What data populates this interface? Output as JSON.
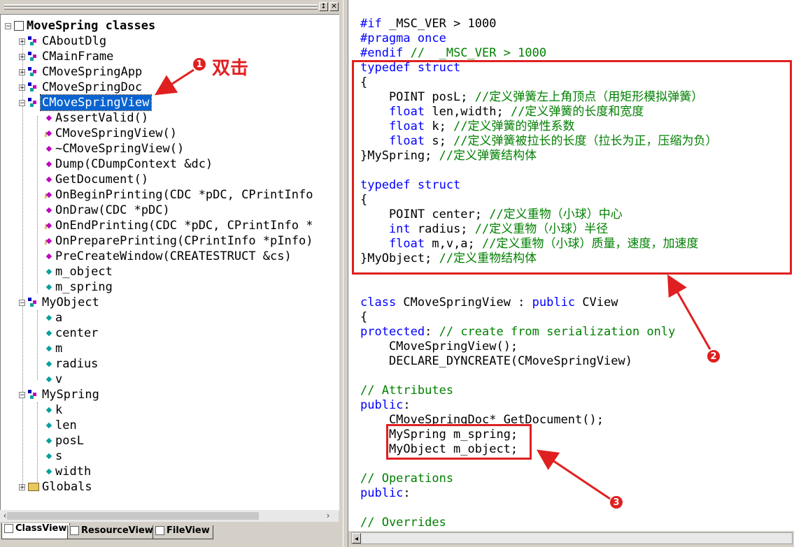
{
  "colors": {
    "keyword": "#0000ff",
    "comment": "#008000",
    "annotation": "#e02020",
    "selection": "#0a64d0"
  },
  "class_tree": {
    "root": "MoveSpring classes",
    "items": [
      {
        "label": "CAboutDlg",
        "icon": "class-icon"
      },
      {
        "label": "CMainFrame",
        "icon": "class-icon"
      },
      {
        "label": "CMoveSpringApp",
        "icon": "class-icon"
      },
      {
        "label": "CMoveSpringDoc",
        "icon": "class-icon"
      },
      {
        "label": "CMoveSpringView",
        "icon": "class-icon",
        "selected": true
      },
      {
        "label": "AssertValid()",
        "icon": "method-icon"
      },
      {
        "label": "CMoveSpringView()",
        "icon": "public-method-key-icon"
      },
      {
        "label": "~CMoveSpringView()",
        "icon": "method-icon"
      },
      {
        "label": "Dump(CDumpContext &dc)",
        "icon": "method-icon"
      },
      {
        "label": "GetDocument()",
        "icon": "method-icon"
      },
      {
        "label": "OnBeginPrinting(CDC *pDC, CPrintInfo",
        "icon": "public-method-key-icon"
      },
      {
        "label": "OnDraw(CDC *pDC)",
        "icon": "method-icon"
      },
      {
        "label": "OnEndPrinting(CDC *pDC, CPrintInfo *",
        "icon": "public-method-key-icon"
      },
      {
        "label": "OnPreparePrinting(CPrintInfo *pInfo)",
        "icon": "public-method-key-icon"
      },
      {
        "label": "PreCreateWindow(CREATESTRUCT &cs)",
        "icon": "method-icon"
      },
      {
        "label": "m_object",
        "icon": "member-icon"
      },
      {
        "label": "m_spring",
        "icon": "member-icon"
      },
      {
        "label": "MyObject",
        "icon": "class-icon"
      },
      {
        "label": "a",
        "icon": "member-icon"
      },
      {
        "label": "center",
        "icon": "member-icon"
      },
      {
        "label": "m",
        "icon": "member-icon"
      },
      {
        "label": "radius",
        "icon": "member-icon"
      },
      {
        "label": "v",
        "icon": "member-icon"
      },
      {
        "label": "MySpring",
        "icon": "class-icon"
      },
      {
        "label": "k",
        "icon": "member-icon"
      },
      {
        "label": "len",
        "icon": "member-icon"
      },
      {
        "label": "posL",
        "icon": "member-icon"
      },
      {
        "label": "s",
        "icon": "member-icon"
      },
      {
        "label": "width",
        "icon": "member-icon"
      },
      {
        "label": "Globals",
        "icon": "folder-icon"
      }
    ]
  },
  "tabs": [
    {
      "label": "ClassView",
      "active": true
    },
    {
      "label": "ResourceView",
      "active": false
    },
    {
      "label": "FileView",
      "active": false
    }
  ],
  "annotations": {
    "badge1": "1",
    "badge2": "2",
    "badge3": "3",
    "note1": "双击"
  },
  "code": [
    {
      "s": "kw",
      "t": "#if"
    },
    {
      "s": "tx",
      "t": " _MSC_VER > 1000"
    },
    {
      "s": "kw",
      "t": "#pragma once"
    },
    {
      "s": "kw",
      "t": "#endif"
    },
    {
      "s": "cm",
      "t": " //  _MSC_VER > 1000"
    },
    {
      "s": "kw",
      "t": "typedef struct"
    },
    {
      "s": "tx",
      "t": "{"
    },
    {
      "s": "tx",
      "t": "    POINT posL; "
    },
    {
      "s": "cm",
      "t": "//定义弹簧左上角顶点（用矩形模拟弹簧）"
    },
    {
      "s": "kw",
      "t": "    float"
    },
    {
      "s": "tx",
      "t": " len,width; "
    },
    {
      "s": "cm",
      "t": "//定义弹簧的长度和宽度"
    },
    {
      "s": "kw",
      "t": "    float"
    },
    {
      "s": "tx",
      "t": " k; "
    },
    {
      "s": "cm",
      "t": "//定义弹簧的弹性系数"
    },
    {
      "s": "kw",
      "t": "    float"
    },
    {
      "s": "tx",
      "t": " s; "
    },
    {
      "s": "cm",
      "t": "//定义弹簧被拉长的长度（拉长为正，压缩为负）"
    },
    {
      "s": "tx",
      "t": "}MySpring; "
    },
    {
      "s": "cm",
      "t": "//定义弹簧结构体"
    },
    {
      "s": "kw",
      "t": "typedef struct"
    },
    {
      "s": "tx",
      "t": "{"
    },
    {
      "s": "tx",
      "t": "    POINT center; "
    },
    {
      "s": "cm",
      "t": "//定义重物（小球）中心"
    },
    {
      "s": "kw",
      "t": "    int"
    },
    {
      "s": "tx",
      "t": " radius; "
    },
    {
      "s": "cm",
      "t": "//定义重物（小球）半径"
    },
    {
      "s": "kw",
      "t": "    float"
    },
    {
      "s": "tx",
      "t": " m,v,a; "
    },
    {
      "s": "cm",
      "t": "//定义重物（小球）质量，速度，加速度"
    },
    {
      "s": "tx",
      "t": "}MyObject; "
    },
    {
      "s": "cm",
      "t": "//定义重物结构体"
    },
    {
      "s": "kw",
      "t": "class"
    },
    {
      "s": "tx",
      "t": " CMoveSpringView : "
    },
    {
      "s": "kw",
      "t": "public"
    },
    {
      "s": "tx",
      "t": " CView"
    },
    {
      "s": "tx",
      "t": "{"
    },
    {
      "s": "kw",
      "t": "protected"
    },
    {
      "s": "tx",
      "t": ": "
    },
    {
      "s": "cm",
      "t": "// create from serialization only"
    },
    {
      "s": "tx",
      "t": "    CMoveSpringView();"
    },
    {
      "s": "tx",
      "t": "    DECLARE_DYNCREATE(CMoveSpringView)"
    },
    {
      "s": "cm",
      "t": "// Attributes"
    },
    {
      "s": "kw",
      "t": "public"
    },
    {
      "s": "tx",
      "t": ":"
    },
    {
      "s": "tx",
      "t": "    CMoveSpringDoc* GetDocument();"
    },
    {
      "s": "tx",
      "t": "    MySpring m_spring;"
    },
    {
      "s": "tx",
      "t": "    MyObject m_object;"
    },
    {
      "s": "cm",
      "t": "// Operations"
    },
    {
      "s": "kw",
      "t": "public"
    },
    {
      "s": "tx",
      "t": ":"
    },
    {
      "s": "cm",
      "t": "// Overrides"
    }
  ]
}
